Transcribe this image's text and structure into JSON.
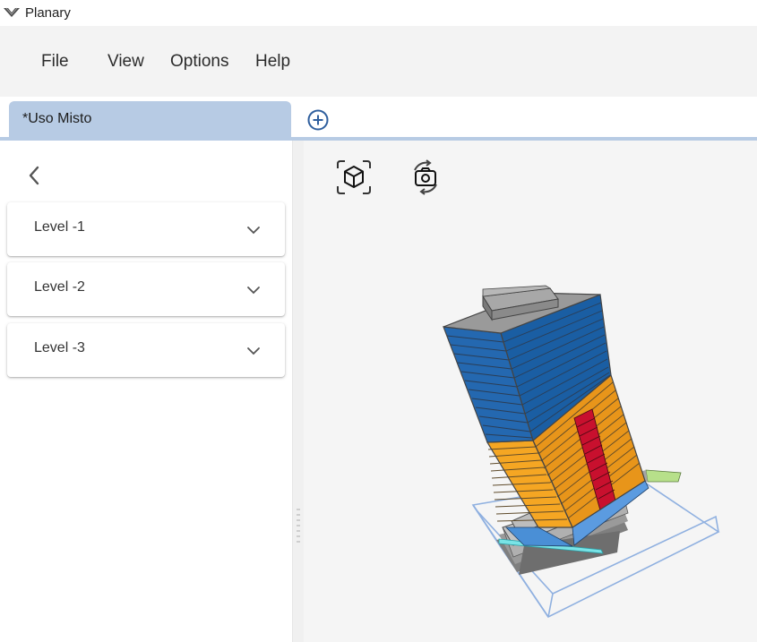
{
  "app": {
    "title": "Planary",
    "logo_icon": "planary-logo-icon"
  },
  "menu": {
    "file": "File",
    "view": "View",
    "options": "Options",
    "help": "Help"
  },
  "tabs": [
    {
      "label": "*Uso Misto",
      "active": true
    }
  ],
  "add_tab_icon": "plus-circle-icon",
  "sidebar": {
    "back_icon": "chevron-left-icon",
    "levels": [
      {
        "label": "Level -1",
        "icon": "chevron-down-icon"
      },
      {
        "label": "Level -2",
        "icon": "chevron-down-icon"
      },
      {
        "label": "Level -3",
        "icon": "chevron-down-icon"
      }
    ]
  },
  "viewport": {
    "tools": [
      {
        "name": "3d-view-icon"
      },
      {
        "name": "camera-rotate-icon"
      }
    ],
    "colors": {
      "office": "#1a5ea3",
      "commercial": "#f5a623",
      "core": "#c8102e",
      "roof": "#8c8c8c",
      "podium": "#bdbdbd",
      "bounding_box": "#8fb0e0",
      "accent_cyan": "#79e3e6",
      "accent_green": "#b7e08a",
      "base_blue": "#4a8fd6"
    }
  }
}
